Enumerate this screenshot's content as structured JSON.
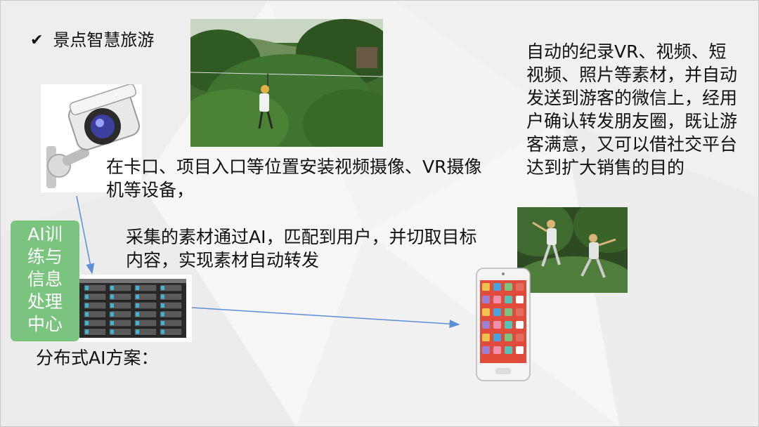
{
  "slide": {
    "title": "景点智慧旅游",
    "install_caption": "在卡口、项目入口等位置安装视频摄像、VR摄像机等设备，",
    "collect_caption": "采集的素材通过AI，匹配到用户，并切取目标内容，实现素材自动转发",
    "right_caption": "自动的纪录VR、视频、短视频、照片等素材，并自动发送到游客的微信上，经用户确认转发朋友圈，既让游客满意，又可以借社交平台达到扩大销售的目的",
    "ai_box_lines": [
      "AI训",
      "练与",
      "信息",
      "处理",
      "中心"
    ],
    "dist_caption": "分布式AI方案："
  },
  "colors": {
    "ai_box": "#7bc47f",
    "arrow": "#5b8fd6"
  },
  "icons": {
    "check": "checkmark-icon"
  }
}
